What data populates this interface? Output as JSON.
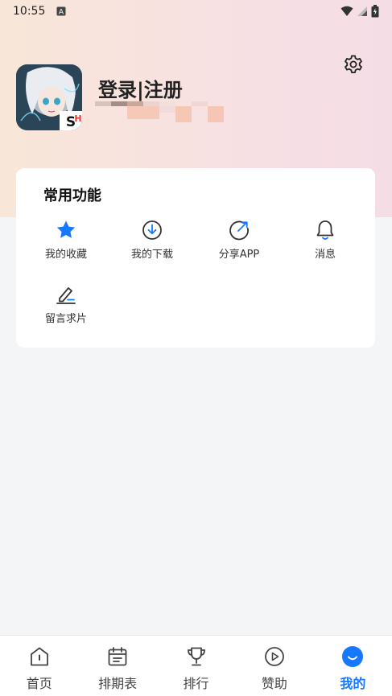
{
  "status_bar": {
    "time": "10:55"
  },
  "profile": {
    "login_label": "登录|注册"
  },
  "functions_card": {
    "title": "常用功能",
    "items": [
      {
        "label": "我的收藏",
        "icon": "star-icon"
      },
      {
        "label": "我的下载",
        "icon": "download-icon"
      },
      {
        "label": "分享APP",
        "icon": "share-icon"
      },
      {
        "label": "消息",
        "icon": "bell-icon"
      },
      {
        "label": "留言求片",
        "icon": "edit-icon"
      }
    ]
  },
  "tab_bar": {
    "tabs": [
      {
        "label": "首页",
        "icon": "home-icon"
      },
      {
        "label": "排期表",
        "icon": "calendar-icon"
      },
      {
        "label": "排行",
        "icon": "trophy-icon"
      },
      {
        "label": "赞助",
        "icon": "play-circle-icon"
      },
      {
        "label": "我的",
        "icon": "profile-icon",
        "active": true
      }
    ]
  },
  "colors": {
    "accent": "#1677ff",
    "hero_start": "#f8e6d8",
    "hero_end": "#f5dde6"
  }
}
